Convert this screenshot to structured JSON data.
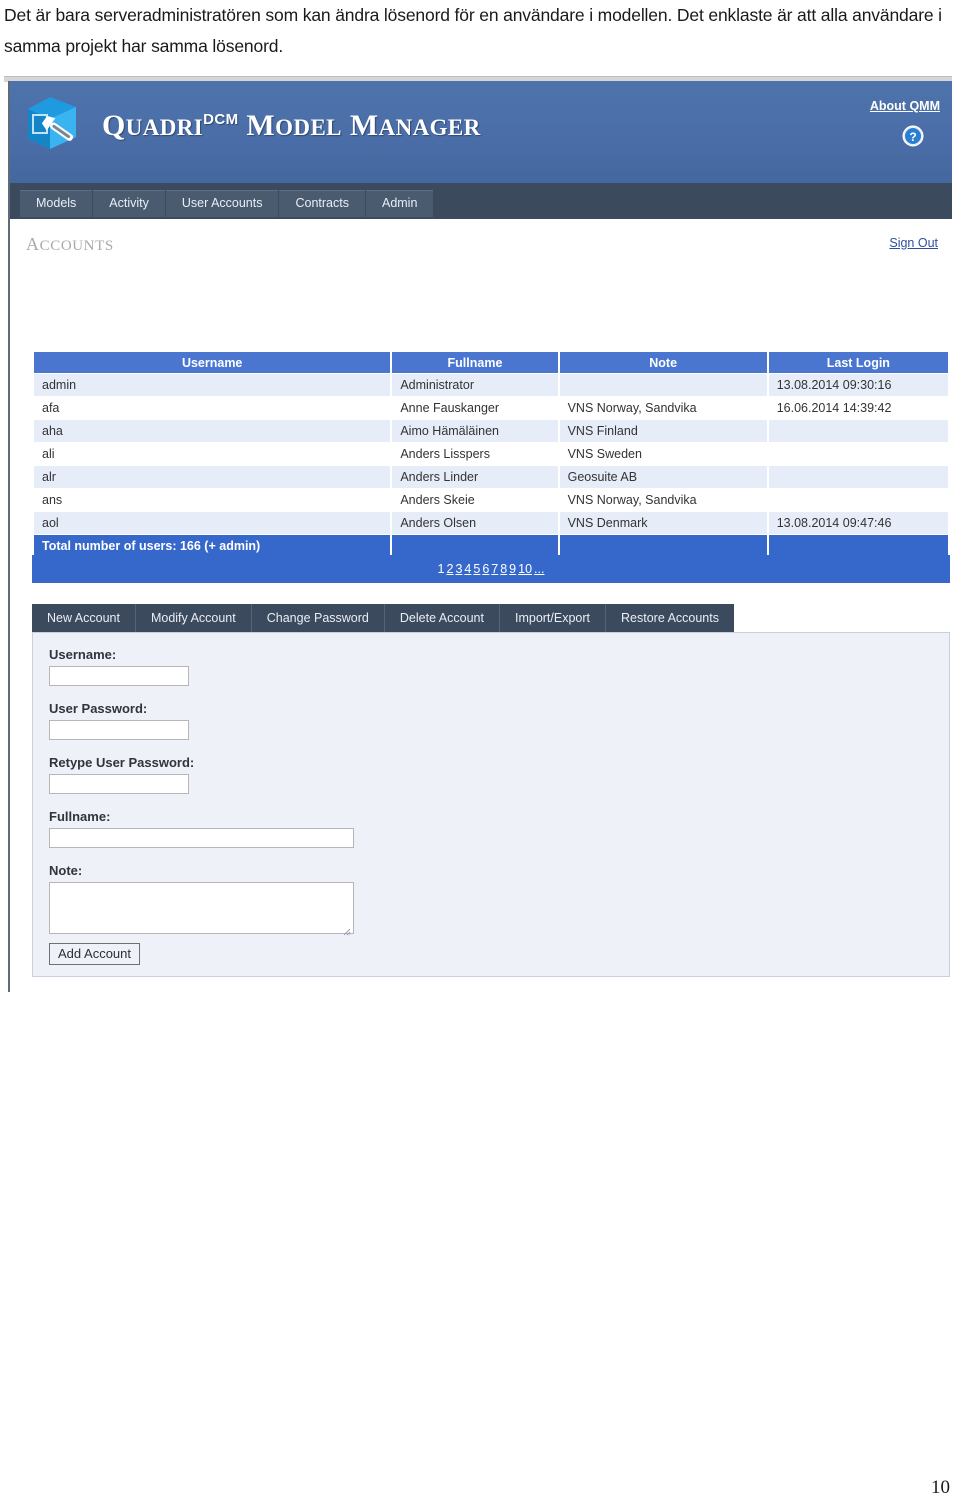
{
  "document": {
    "body_text": "Det är bara serveradministratören som kan ändra lösenord för en användare i modellen. Det enklaste är att alla användare i samma projekt har samma lösenord.",
    "page_number": "10"
  },
  "app": {
    "title_quadri": "Q",
    "title_quadri_rest": "UADRI",
    "title_sup": "DCM",
    "title_model_m": "M",
    "title_model_rest": "ODEL",
    "title_manager_m": "M",
    "title_manager_rest": "ANAGER",
    "logo_icon": "cube-wrench-icon",
    "about_link": "About QMM",
    "help_icon": "question-mark-circle-icon"
  },
  "nav": {
    "tabs": [
      {
        "label": "Models"
      },
      {
        "label": "Activity"
      },
      {
        "label": "User Accounts"
      },
      {
        "label": "Contracts"
      },
      {
        "label": "Admin"
      }
    ]
  },
  "content": {
    "section_title_cap": "A",
    "section_title_rest": "CCOUNTS",
    "sign_out": "Sign Out"
  },
  "table": {
    "columns": [
      "Username",
      "Fullname",
      "Note",
      "Last Login"
    ],
    "rows": [
      {
        "username": "admin",
        "fullname": "Administrator",
        "note": "",
        "last_login": "13.08.2014 09:30:16"
      },
      {
        "username": "afa",
        "fullname": "Anne Fauskanger",
        "note": "VNS Norway, Sandvika",
        "last_login": "16.06.2014 14:39:42"
      },
      {
        "username": "aha",
        "fullname": "Aimo Hämäläinen",
        "note": "VNS Finland",
        "last_login": ""
      },
      {
        "username": "ali",
        "fullname": "Anders Lisspers",
        "note": "VNS Sweden",
        "last_login": ""
      },
      {
        "username": "alr",
        "fullname": "Anders Linder",
        "note": "Geosuite AB",
        "last_login": ""
      },
      {
        "username": "ans",
        "fullname": "Anders Skeie",
        "note": "VNS Norway, Sandvika",
        "last_login": ""
      },
      {
        "username": "aol",
        "fullname": "Anders Olsen",
        "note": "VNS Denmark",
        "last_login": "13.08.2014 09:47:46"
      }
    ],
    "total_label": "Total number of users: 166 (+ admin)"
  },
  "pagination": {
    "pages": [
      "1",
      "2",
      "3",
      "4",
      "5",
      "6",
      "7",
      "8",
      "9",
      "10",
      "..."
    ],
    "current": "1"
  },
  "actions": {
    "buttons": [
      {
        "label": "New Account"
      },
      {
        "label": "Modify Account"
      },
      {
        "label": "Change Password"
      },
      {
        "label": "Delete Account"
      },
      {
        "label": "Import/Export"
      },
      {
        "label": "Restore Accounts"
      }
    ]
  },
  "form": {
    "username_label": "Username:",
    "username_value": "",
    "password_label": "User Password:",
    "password_value": "",
    "retype_label": "Retype User Password:",
    "retype_value": "",
    "fullname_label": "Fullname:",
    "fullname_value": "",
    "note_label": "Note:",
    "note_value": "",
    "submit_label": "Add Account"
  },
  "colors": {
    "header_blue": "#4a6da7",
    "nav_dark": "#3c4a5e",
    "table_header_blue": "#4a76d0",
    "total_row_blue": "#3668cc",
    "row_stripe": "#e6ecf8",
    "form_panel_bg": "#eef1f8",
    "link_blue": "#2f4f9e"
  }
}
